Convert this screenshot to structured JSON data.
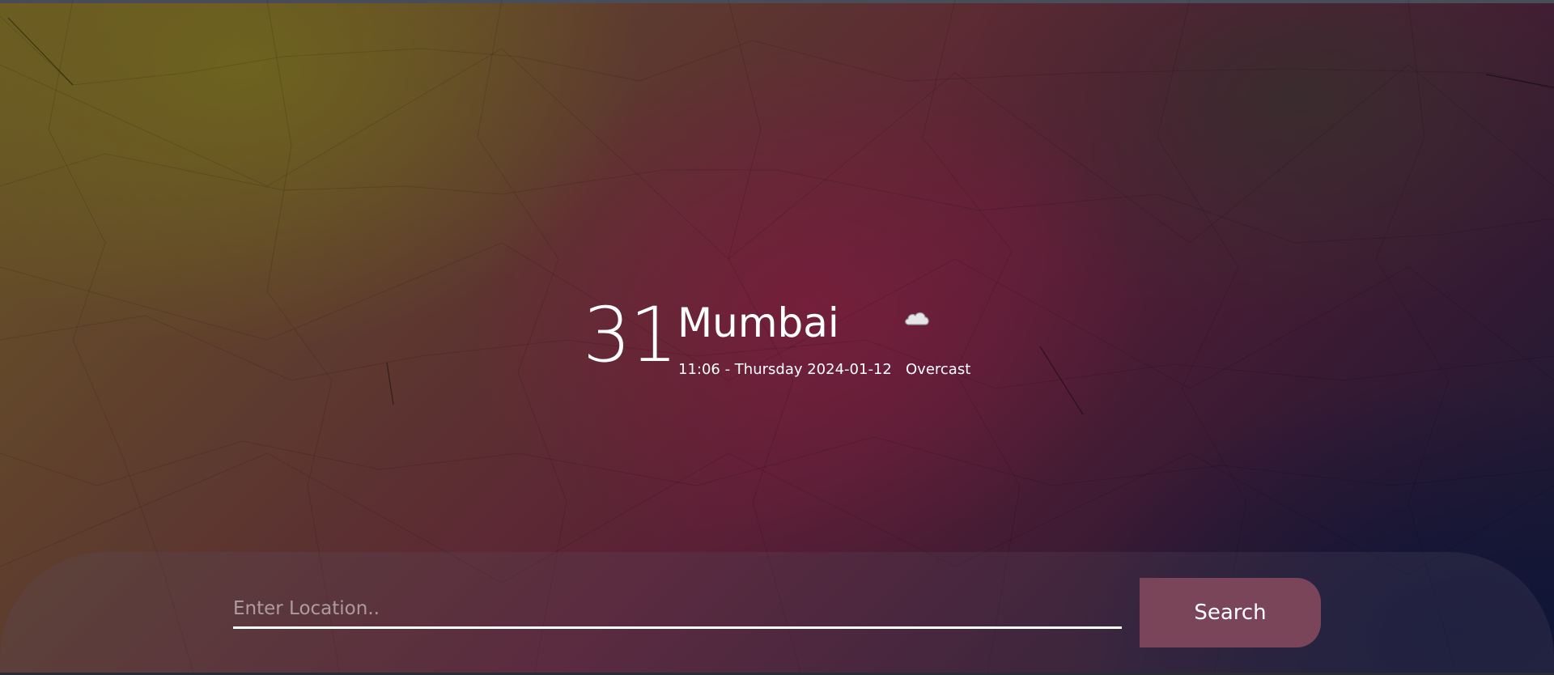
{
  "weather": {
    "temperature": "31",
    "city": "Mumbai",
    "datetime": "11:06 - Thursday 2024-01-12",
    "condition": "Overcast",
    "condition_icon": "cloud-icon"
  },
  "search": {
    "placeholder": "Enter Location..",
    "value": "",
    "button_label": "Search"
  },
  "colors": {
    "background_top_left": "#6a5a24",
    "background_center": "#5b2036",
    "background_bottom_right": "#141a33",
    "button": "#7a4459",
    "text": "#ffffff"
  }
}
